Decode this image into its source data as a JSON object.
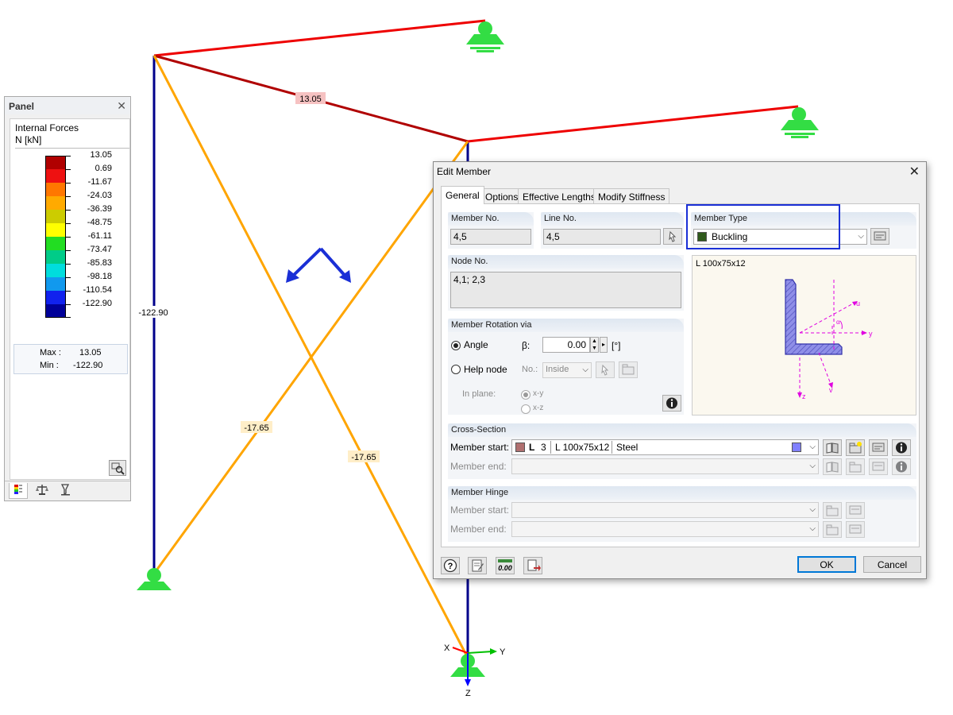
{
  "model": {
    "labels": {
      "top_beam": "13.05",
      "left_column": "-122.90",
      "brace_1": "-17.65",
      "brace_2": "-17.65"
    },
    "axes": {
      "x": "X",
      "y": "Y",
      "z": "Z"
    },
    "colors": {
      "beam": "#ff0000",
      "beam_dark": "#b00000",
      "column": "#00008b",
      "brace": "#ffa500",
      "support": "#33dd44",
      "direction": "#1a2fd6",
      "axis_x": "#ff0000",
      "axis_y": "#00c000",
      "axis_z": "#0000ff"
    }
  },
  "panel": {
    "title": "Panel",
    "heading": "Internal Forces",
    "unit": "N [kN]",
    "scale": [
      {
        "value": "13.05",
        "color": "#b00000"
      },
      {
        "value": "0.69",
        "color": "#ee1111"
      },
      {
        "value": "-11.67",
        "color": "#ff7700"
      },
      {
        "value": "-24.03",
        "color": "#ffaa00"
      },
      {
        "value": "-36.39",
        "color": "#cccc00"
      },
      {
        "value": "-48.75",
        "color": "#ffff00"
      },
      {
        "value": "-61.11",
        "color": "#22dd22"
      },
      {
        "value": "-73.47",
        "color": "#00cc88"
      },
      {
        "value": "-85.83",
        "color": "#00dddd"
      },
      {
        "value": "-98.18",
        "color": "#1199ee"
      },
      {
        "value": "-110.54",
        "color": "#1122ee"
      },
      {
        "value": "-122.90",
        "color": "#000099"
      }
    ],
    "max_label": "Max :",
    "max_value": "13.05",
    "min_label": "Min :",
    "min_value": "-122.90",
    "close_glyph": "✕"
  },
  "dialog": {
    "title": "Edit Member",
    "close_glyph": "✕",
    "tabs": [
      "General",
      "Options",
      "Effective Lengths",
      "Modify Stiffness"
    ],
    "member_no": {
      "label": "Member No.",
      "value": "4,5"
    },
    "line_no": {
      "label": "Line No.",
      "value": "4,5"
    },
    "member_type": {
      "label": "Member Type",
      "value": "Buckling",
      "color": "#2f5a1c"
    },
    "node_no": {
      "label": "Node No.",
      "value": "4,1; 2,3"
    },
    "section_preview": {
      "name": "L 100x75x12",
      "axes": {
        "y": "y",
        "z": "z",
        "u": "u",
        "v": "v",
        "alpha": "α"
      }
    },
    "rotation": {
      "label": "Member Rotation via",
      "angle": "Angle",
      "beta": "β:",
      "beta_value": "0.00",
      "beta_unit": "[°]",
      "help_node": "Help node",
      "no": "No.:",
      "no_value": "Inside",
      "in_plane": "In plane:",
      "xy": "x-y",
      "xz": "x-z"
    },
    "cross_section": {
      "label": "Cross-Section",
      "start_label": "Member start:",
      "end_label": "Member end:",
      "start_prefix": "L",
      "start_no": "3",
      "start_name": "L 100x75x12",
      "start_material": "Steel",
      "start_color": "#b07070",
      "material_color": "#8080ff"
    },
    "hinge": {
      "label": "Member Hinge",
      "start_label": "Member start:",
      "end_label": "Member end:"
    },
    "ok": "OK",
    "cancel": "Cancel",
    "zero_label": "0.00"
  }
}
